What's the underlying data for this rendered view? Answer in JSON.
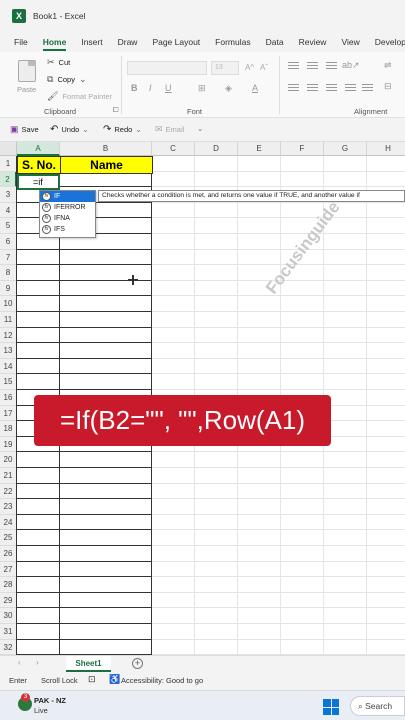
{
  "window": {
    "title": "Book1  -  Excel",
    "app_icon": "excel-icon"
  },
  "ribbon_tabs": [
    "File",
    "Home",
    "Insert",
    "Draw",
    "Page Layout",
    "Formulas",
    "Data",
    "Review",
    "View",
    "Develope"
  ],
  "active_tab": "Home",
  "ribbon": {
    "paste_label": "Paste",
    "cut_label": "Cut",
    "copy_label": "Copy",
    "format_painter_label": "Format Painter",
    "clipboard_group": "Clipboard",
    "font_group": "Font",
    "alignment_group": "Alignment",
    "font_size": "13",
    "bold": "B",
    "italic": "I",
    "underline": "U"
  },
  "qat": {
    "save_label": "Save",
    "undo_label": "Undo",
    "redo_label": "Redo",
    "email_label": "Email"
  },
  "grid": {
    "columns": [
      "A",
      "B",
      "C",
      "D",
      "E",
      "F",
      "G",
      "H"
    ],
    "rows": [
      "1",
      "2",
      "3",
      "4",
      "5",
      "6",
      "7",
      "8",
      "9",
      "10",
      "11",
      "12",
      "13",
      "14",
      "15",
      "16",
      "17",
      "18",
      "19",
      "20",
      "21",
      "22",
      "23",
      "24",
      "25",
      "26",
      "27",
      "28",
      "29",
      "30",
      "31",
      "32"
    ],
    "header_a": "S. No.",
    "header_b": "Name",
    "active_cell_text": "=if",
    "active_cell_ref": "A2",
    "header_fill": "#ffff00"
  },
  "autocomplete": {
    "items": [
      "IF",
      "IFERROR",
      "IFNA",
      "IFS"
    ],
    "selected": "IF",
    "tooltip": "Checks whether a condition is met, and returns one value if TRUE, and another value if"
  },
  "watermark": "Focusinguide",
  "banner": {
    "text": "=If(B2=\"\", \"\",Row(A1)",
    "color": "#c81a2b"
  },
  "sheets": {
    "tabs": [
      "Sheet1"
    ],
    "active": "Sheet1"
  },
  "status": {
    "mode": "Enter",
    "scroll_lock": "Scroll Lock",
    "accessibility": "Accessibility: Good to go"
  },
  "taskbar": {
    "news_title": "PAK - NZ",
    "news_sub": "Live",
    "badge": "3",
    "search_label": "Search"
  },
  "colors": {
    "accent": "#1d6f42"
  }
}
